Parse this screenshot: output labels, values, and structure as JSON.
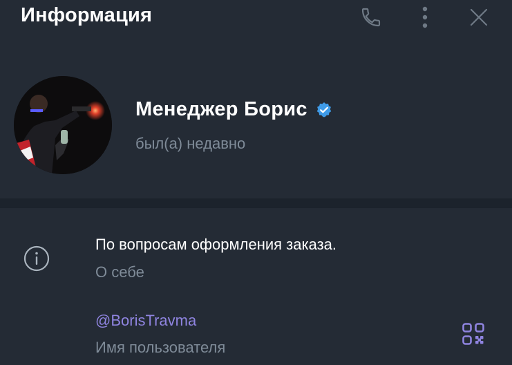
{
  "header": {
    "title": "Информация",
    "call_icon": "phone-icon",
    "more_icon": "more-vertical-icon",
    "close_icon": "close-icon"
  },
  "profile": {
    "name": "Менеджер Борис",
    "verified_icon": "verified-badge-icon",
    "status": "был(а) недавно"
  },
  "info": {
    "icon": "info-icon",
    "bio": "По вопросам оформления заказа.",
    "bio_label": "О себе",
    "username": "@BorisTravma",
    "username_label": "Имя пользователя",
    "qr_icon": "qr-code-icon"
  },
  "colors": {
    "background": "#242b35",
    "divider": "#1c232c",
    "muted_text": "#7f8b98",
    "accent": "#8f84e0",
    "verified": "#3f9be8"
  }
}
